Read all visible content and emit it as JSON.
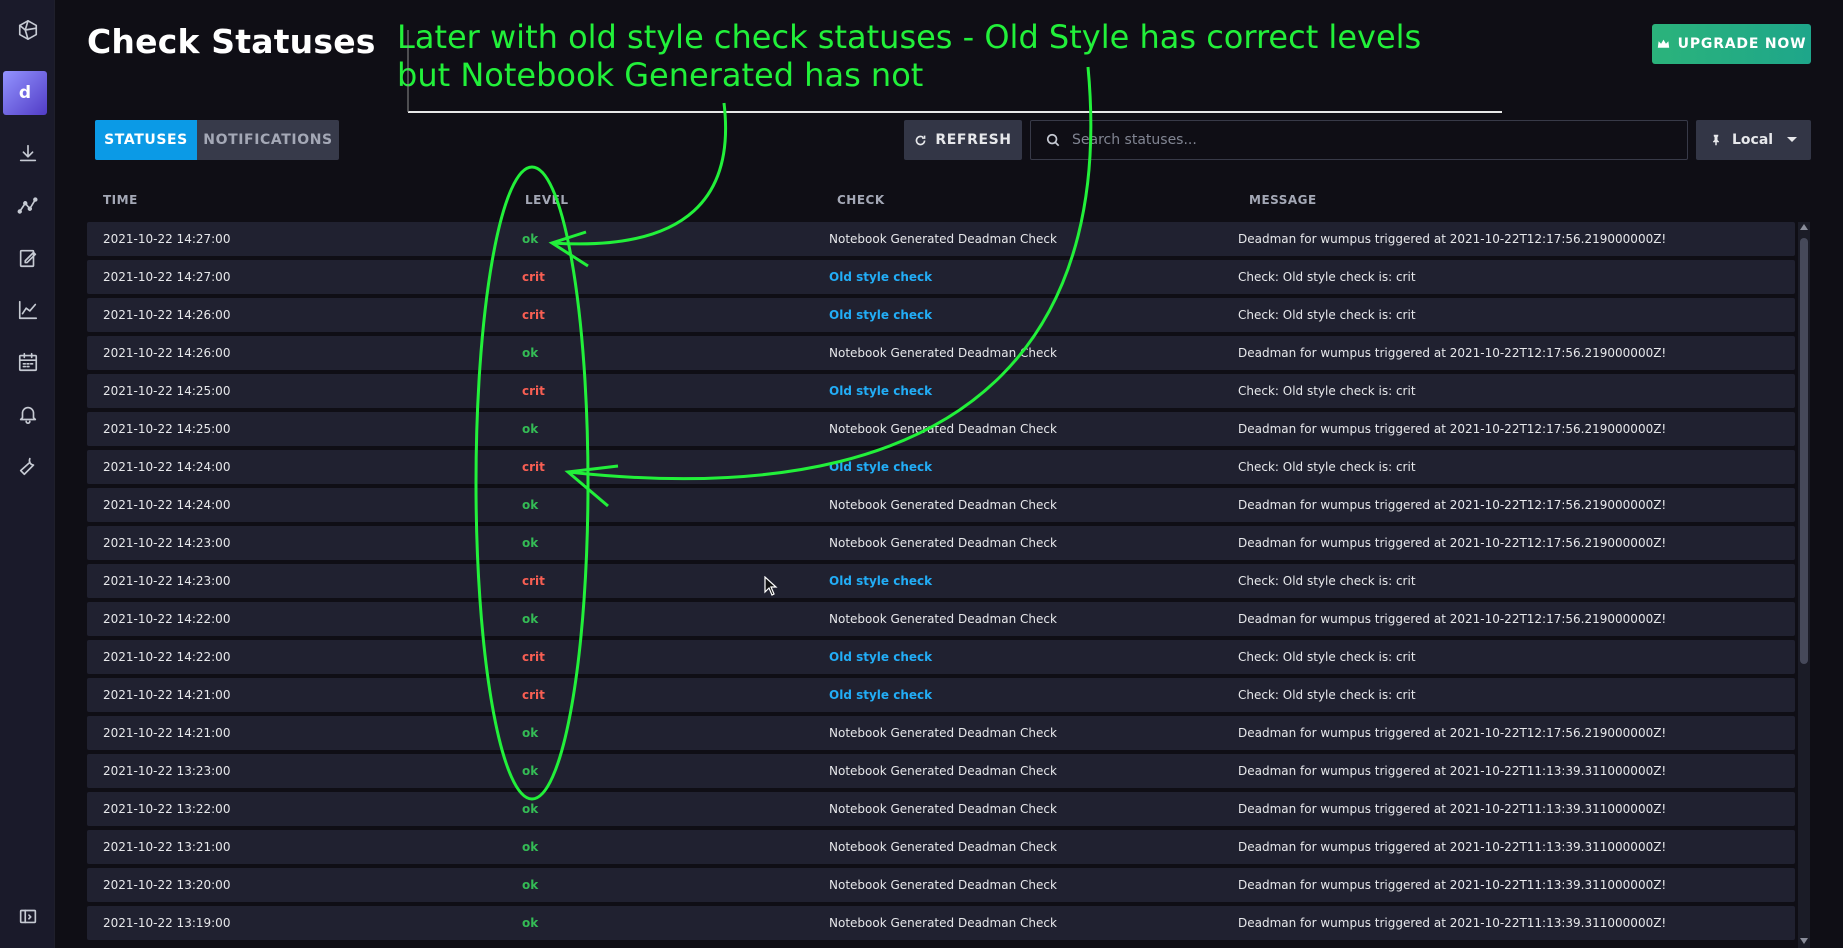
{
  "page": {
    "title": "Check Statuses"
  },
  "sidebar": {
    "org_initial": "d",
    "items": [
      {
        "name": "logo-icon"
      },
      {
        "name": "load-data-icon"
      },
      {
        "name": "data-explorer-icon"
      },
      {
        "name": "notebooks-icon"
      },
      {
        "name": "dashboards-icon"
      },
      {
        "name": "tasks-icon"
      },
      {
        "name": "alerts-icon"
      },
      {
        "name": "settings-icon"
      },
      {
        "name": "collapse-icon"
      }
    ]
  },
  "header": {
    "upgrade_label": "UPGRADE NOW"
  },
  "tabs": [
    {
      "label": "STATUSES",
      "active": true
    },
    {
      "label": "NOTIFICATIONS",
      "active": false
    }
  ],
  "toolbar": {
    "refresh_label": "REFRESH",
    "search_placeholder": "Search statuses...",
    "timezone_label": "Local"
  },
  "table": {
    "columns": [
      "TIME",
      "LEVEL",
      "CHECK",
      "MESSAGE"
    ],
    "rows": [
      {
        "time": "2021-10-22 14:27:00",
        "level": "ok",
        "check": "Notebook Generated Deadman Check",
        "message": "Deadman for wumpus triggered at 2021-10-22T12:17:56.219000000Z!"
      },
      {
        "time": "2021-10-22 14:27:00",
        "level": "crit",
        "check": "Old style check",
        "message": "Check: Old style check is: crit"
      },
      {
        "time": "2021-10-22 14:26:00",
        "level": "crit",
        "check": "Old style check",
        "message": "Check: Old style check is: crit"
      },
      {
        "time": "2021-10-22 14:26:00",
        "level": "ok",
        "check": "Notebook Generated Deadman Check",
        "message": "Deadman for wumpus triggered at 2021-10-22T12:17:56.219000000Z!"
      },
      {
        "time": "2021-10-22 14:25:00",
        "level": "crit",
        "check": "Old style check",
        "message": "Check: Old style check is: crit"
      },
      {
        "time": "2021-10-22 14:25:00",
        "level": "ok",
        "check": "Notebook Generated Deadman Check",
        "message": "Deadman for wumpus triggered at 2021-10-22T12:17:56.219000000Z!"
      },
      {
        "time": "2021-10-22 14:24:00",
        "level": "crit",
        "check": "Old style check",
        "message": "Check: Old style check is: crit"
      },
      {
        "time": "2021-10-22 14:24:00",
        "level": "ok",
        "check": "Notebook Generated Deadman Check",
        "message": "Deadman for wumpus triggered at 2021-10-22T12:17:56.219000000Z!"
      },
      {
        "time": "2021-10-22 14:23:00",
        "level": "ok",
        "check": "Notebook Generated Deadman Check",
        "message": "Deadman for wumpus triggered at 2021-10-22T12:17:56.219000000Z!"
      },
      {
        "time": "2021-10-22 14:23:00",
        "level": "crit",
        "check": "Old style check",
        "message": "Check: Old style check is: crit"
      },
      {
        "time": "2021-10-22 14:22:00",
        "level": "ok",
        "check": "Notebook Generated Deadman Check",
        "message": "Deadman for wumpus triggered at 2021-10-22T12:17:56.219000000Z!"
      },
      {
        "time": "2021-10-22 14:22:00",
        "level": "crit",
        "check": "Old style check",
        "message": "Check: Old style check is: crit"
      },
      {
        "time": "2021-10-22 14:21:00",
        "level": "crit",
        "check": "Old style check",
        "message": "Check: Old style check is: crit"
      },
      {
        "time": "2021-10-22 14:21:00",
        "level": "ok",
        "check": "Notebook Generated Deadman Check",
        "message": "Deadman for wumpus triggered at 2021-10-22T12:17:56.219000000Z!"
      },
      {
        "time": "2021-10-22 13:23:00",
        "level": "ok",
        "check": "Notebook Generated Deadman Check",
        "message": "Deadman for wumpus triggered at 2021-10-22T11:13:39.311000000Z!"
      },
      {
        "time": "2021-10-22 13:22:00",
        "level": "ok",
        "check": "Notebook Generated Deadman Check",
        "message": "Deadman for wumpus triggered at 2021-10-22T11:13:39.311000000Z!"
      },
      {
        "time": "2021-10-22 13:21:00",
        "level": "ok",
        "check": "Notebook Generated Deadman Check",
        "message": "Deadman for wumpus triggered at 2021-10-22T11:13:39.311000000Z!"
      },
      {
        "time": "2021-10-22 13:20:00",
        "level": "ok",
        "check": "Notebook Generated Deadman Check",
        "message": "Deadman for wumpus triggered at 2021-10-22T11:13:39.311000000Z!"
      },
      {
        "time": "2021-10-22 13:19:00",
        "level": "ok",
        "check": "Notebook Generated Deadman Check",
        "message": "Deadman for wumpus triggered at 2021-10-22T11:13:39.311000000Z!"
      }
    ]
  },
  "annotation": {
    "line1": "Later with old style check statuses - Old Style has correct levels",
    "line2": "but Notebook Generated has not",
    "color": "#22f03a"
  },
  "colors": {
    "ok": "#34bb55",
    "crit": "#f95f53",
    "link": "#22adf6",
    "accent": "#0b9ae6"
  }
}
